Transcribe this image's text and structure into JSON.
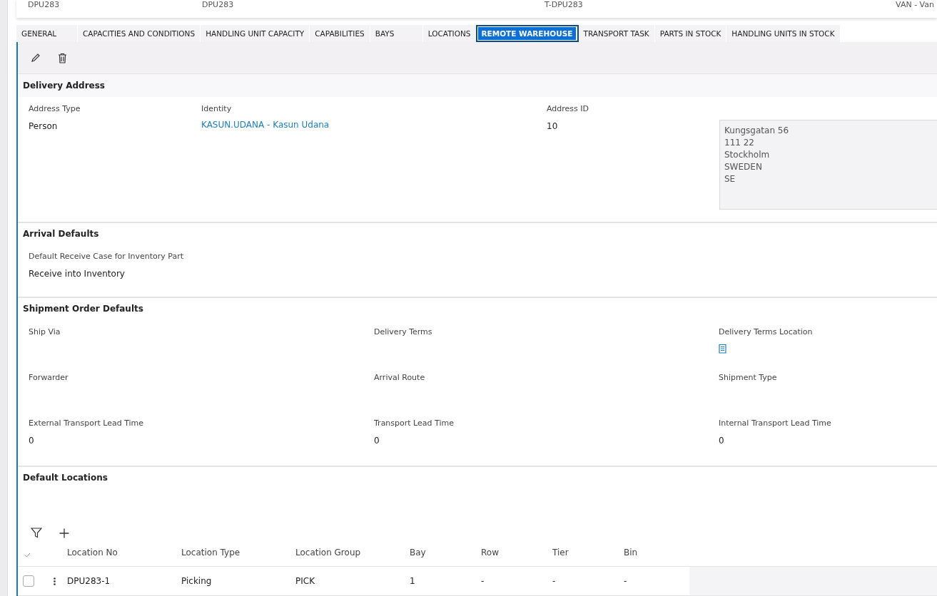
{
  "header": {
    "values": [
      "DPU283",
      "DPU283",
      "T-DPU283",
      "VAN - Van"
    ]
  },
  "tabs": [
    {
      "label": "GENERAL",
      "selected": false
    },
    {
      "label": "CAPACITIES AND CONDITIONS",
      "selected": false
    },
    {
      "label": "HANDLING UNIT CAPACITY",
      "selected": false
    },
    {
      "label": "CAPABILITIES",
      "selected": false
    },
    {
      "label": "BAYS",
      "selected": false
    },
    {
      "label": "LOCATIONS",
      "selected": false
    },
    {
      "label": "REMOTE WAREHOUSE",
      "selected": true
    },
    {
      "label": "TRANSPORT TASK",
      "selected": false
    },
    {
      "label": "PARTS IN STOCK",
      "selected": false
    },
    {
      "label": "HANDLING UNITS IN STOCK",
      "selected": false
    }
  ],
  "delivery_address": {
    "title": "Delivery Address",
    "fields": [
      {
        "label": "Address Type",
        "value": "Person",
        "kind": "text"
      },
      {
        "label": "Identity",
        "value": "KASUN.UDANA - Kasun Udana",
        "kind": "link"
      },
      {
        "label": "Address ID",
        "value": "10",
        "kind": "text"
      }
    ],
    "address_lines": [
      "Kungsgatan 56",
      "111 22",
      "Stockholm",
      "SWEDEN",
      "SE"
    ]
  },
  "arrival_defaults": {
    "title": "Arrival Defaults",
    "fields": [
      {
        "label": "Default Receive Case for Inventory Part",
        "value": "Receive into Inventory",
        "kind": "text"
      }
    ]
  },
  "shipment_order_defaults": {
    "title": "Shipment Order Defaults",
    "fields": [
      {
        "label": "Ship Via",
        "kind": "empty"
      },
      {
        "label": "Delivery Terms",
        "kind": "empty"
      },
      {
        "label": "Delivery Terms Location",
        "kind": "icon"
      },
      {
        "label": "Forwarder",
        "kind": "empty"
      },
      {
        "label": "Arrival Route",
        "kind": "empty"
      },
      {
        "label": "Shipment Type",
        "kind": "empty"
      },
      {
        "label": "External Transport Lead Time",
        "value": "0",
        "kind": "text"
      },
      {
        "label": "Transport Lead Time",
        "value": "0",
        "kind": "text"
      },
      {
        "label": "Internal Transport Lead Time",
        "value": "0",
        "kind": "text"
      }
    ]
  },
  "default_locations": {
    "title": "Default Locations",
    "table": {
      "columns": [
        "Location No",
        "Location Type",
        "Location Group",
        "Bay",
        "Row",
        "Tier",
        "Bin"
      ],
      "rows": [
        {
          "selected": false,
          "cells": [
            "DPU283-1",
            "Picking",
            "PICK",
            "1",
            "-",
            "-",
            "-"
          ]
        }
      ]
    }
  }
}
